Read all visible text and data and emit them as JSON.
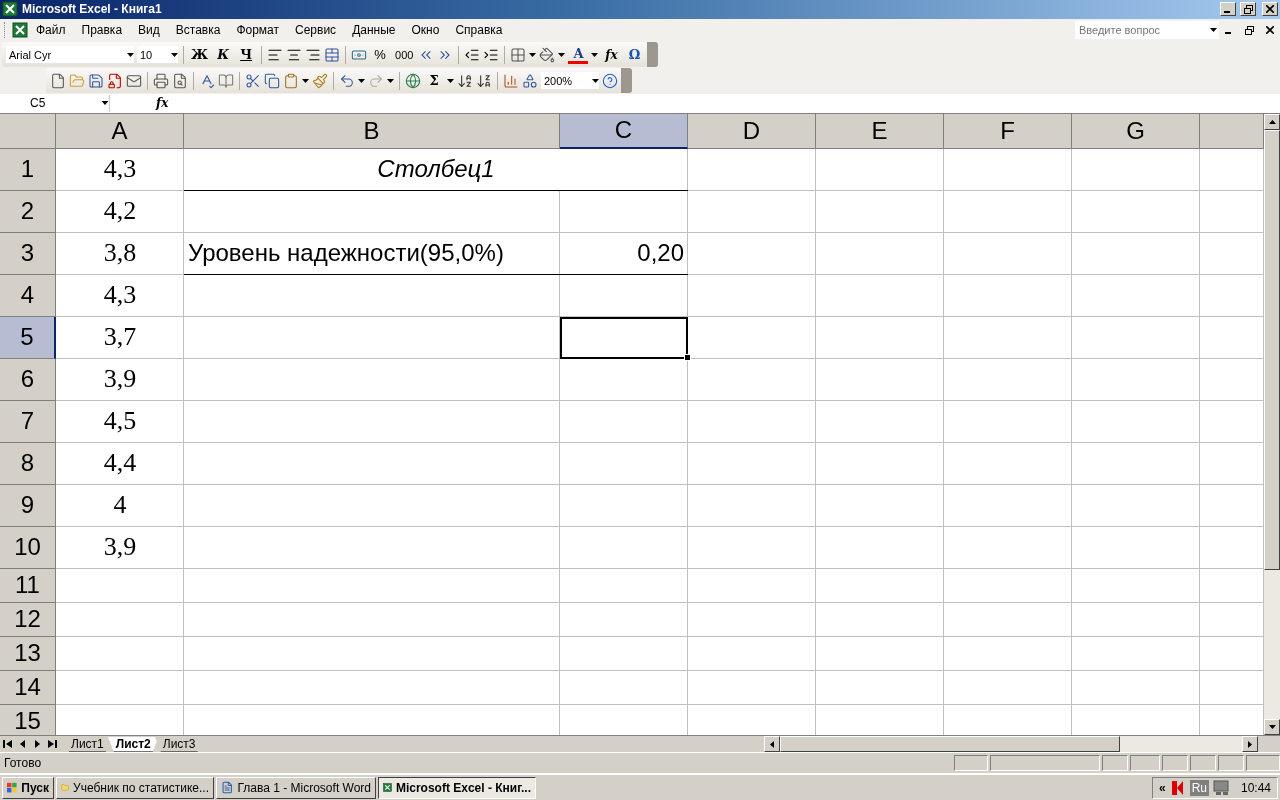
{
  "window": {
    "title": "Microsoft Excel - Книга1"
  },
  "menu": [
    "Файл",
    "Правка",
    "Вид",
    "Вставка",
    "Формат",
    "Сервис",
    "Данные",
    "Окно",
    "Справка"
  ],
  "help_search": {
    "placeholder": "Введите вопрос"
  },
  "formatting_toolbar": {
    "font": "Arial Cyr",
    "size": "10",
    "bold": "Ж",
    "italic": "К",
    "underline": "Ч",
    "percent": "%",
    "thousands": "000",
    "font_color": "A",
    "function": "fx",
    "symbol": "Ω"
  },
  "standard_toolbar": {
    "autosum": "Σ",
    "zoom": "200%"
  },
  "formula_bar": {
    "name_box": "C5",
    "fx": "fx"
  },
  "columns": [
    {
      "label": "A",
      "selected": false
    },
    {
      "label": "B",
      "selected": false
    },
    {
      "label": "C",
      "selected": true
    },
    {
      "label": "D",
      "selected": false
    },
    {
      "label": "E",
      "selected": false
    },
    {
      "label": "F",
      "selected": false
    },
    {
      "label": "G",
      "selected": false
    }
  ],
  "rows": [
    {
      "header": "1",
      "selected": false,
      "kind": "heading",
      "border_bottom": true,
      "a": "4,3",
      "b": "Столбец1"
    },
    {
      "header": "2",
      "selected": false,
      "kind": "plain",
      "border_bottom": false,
      "a": "4,2"
    },
    {
      "header": "3",
      "selected": false,
      "kind": "plain",
      "border_bottom": true,
      "a": "3,8",
      "b": "Уровень надежности(95,0%)",
      "c": "0,20"
    },
    {
      "header": "4",
      "selected": false,
      "kind": "plain",
      "border_bottom": false,
      "a": "4,3"
    },
    {
      "header": "5",
      "selected": true,
      "kind": "plain",
      "border_bottom": false,
      "a": "3,7"
    },
    {
      "header": "6",
      "selected": false,
      "kind": "plain",
      "border_bottom": false,
      "a": "3,9"
    },
    {
      "header": "7",
      "selected": false,
      "kind": "plain",
      "border_bottom": false,
      "a": "4,5"
    },
    {
      "header": "8",
      "selected": false,
      "kind": "plain",
      "border_bottom": false,
      "a": "4,4"
    },
    {
      "header": "9",
      "selected": false,
      "kind": "plain",
      "border_bottom": false,
      "a": "4"
    },
    {
      "header": "10",
      "selected": false,
      "kind": "plain",
      "border_bottom": false,
      "a": "3,9"
    },
    {
      "header": "11",
      "selected": false,
      "kind": "plain",
      "border_bottom": false
    },
    {
      "header": "12",
      "selected": false,
      "kind": "plain",
      "border_bottom": false
    },
    {
      "header": "13",
      "selected": false,
      "kind": "plain",
      "border_bottom": false
    },
    {
      "header": "14",
      "selected": false,
      "kind": "plain",
      "border_bottom": false
    },
    {
      "header": "15",
      "selected": false,
      "kind": "plain",
      "border_bottom": false
    }
  ],
  "sheet_tabs": [
    {
      "label": "Лист1",
      "selected": false
    },
    {
      "label": "Лист2",
      "selected": true
    },
    {
      "label": "Лист3",
      "selected": false
    }
  ],
  "status_bar": {
    "text": "Готово"
  },
  "taskbar": {
    "start": "Пуск",
    "tasks": [
      {
        "label": "Учебник по статистике...",
        "selected": false,
        "kind": "folder"
      },
      {
        "label": "Глава 1 - Microsoft Word",
        "selected": false,
        "kind": "word"
      },
      {
        "label": "Microsoft Excel - Книг...",
        "selected": true,
        "kind": "excel"
      }
    ],
    "tray": {
      "expand": "«",
      "language": "Ru",
      "clock": "10:44"
    }
  }
}
